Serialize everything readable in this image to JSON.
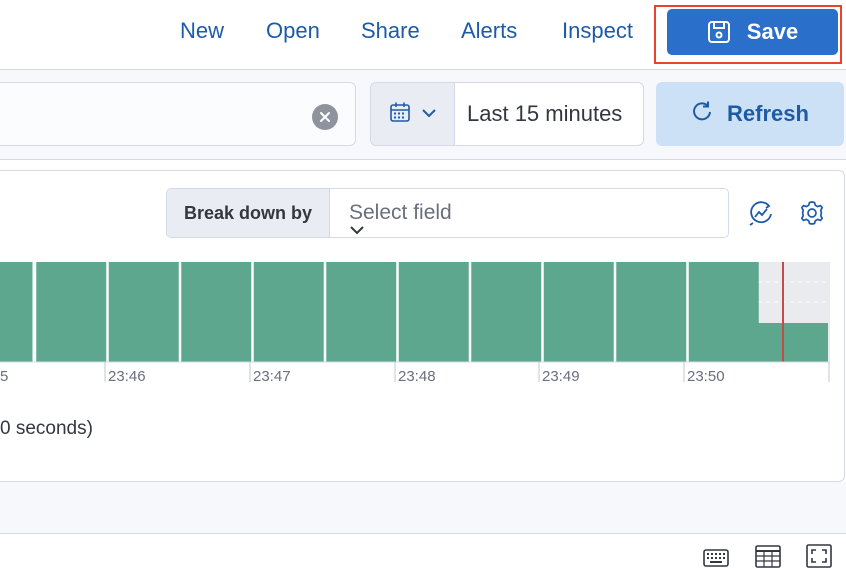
{
  "nav": {
    "new_label": "New",
    "open_label": "Open",
    "share_label": "Share",
    "alerts_label": "Alerts",
    "inspect_label": "Inspect",
    "save_label": "Save",
    "save_icon": "save-icon"
  },
  "query": {
    "clear_icon": "clear-icon"
  },
  "date_picker": {
    "icon": "calendar-icon",
    "range_label": "Last 15 minutes"
  },
  "refresh": {
    "label": "Refresh",
    "icon": "refresh-icon"
  },
  "breakdown": {
    "label": "Break down by",
    "placeholder": "Select field"
  },
  "toolbar_icons": [
    "visualize-icon",
    "gear-icon"
  ],
  "chart_data": {
    "type": "bar",
    "tick_labels": [
      "5",
      "23:46",
      "23:47",
      "23:48",
      "23:49",
      "23:50"
    ],
    "bar_color": "#5ea78f",
    "partial_bar_color": "#5ea78f",
    "highlight_line_color": "#c44b4b"
  },
  "interval_text": "0 seconds)",
  "bottom_icons": [
    "keyboard-icon",
    "table-icon",
    "fullscreen-icon"
  ],
  "colors": {
    "accent": "#2a6fc9",
    "link": "#1d5ba6",
    "outline": "#e7442c"
  }
}
